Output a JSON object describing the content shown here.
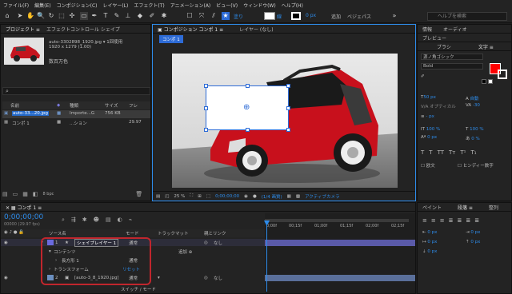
{
  "menu": [
    "ファイル(F)",
    "編集(E)",
    "コンポジション(C)",
    "レイヤー(L)",
    "エフェクト(T)",
    "アニメーション(A)",
    "ビュー(V)",
    "ウィンドウ(W)",
    "ヘルプ(H)"
  ],
  "toolbar": {
    "fill_label": "塗り",
    "stroke_label": "線",
    "stroke_value": "0 px",
    "add_label": "追加",
    "bezier_label": "ベジェパス",
    "search_placeholder": "ヘルプを検索"
  },
  "project": {
    "tab_project": "プロジェクト ≡",
    "tab_effect": "エフェクトコントロール シェイプ",
    "item_name": "auto-3302898_1920.jpg ▾ 1回使用",
    "item_info": "1920 x 1279 (1.00)",
    "item_color": "数百万色",
    "col_name": "名前",
    "col_type": "種類",
    "col_size": "サイズ",
    "col_frame": "フレ",
    "rows": [
      {
        "name": "auto-33...20.jpg",
        "type": "Importe...G",
        "size": "756 KB",
        "frame": ""
      },
      {
        "name": "コンポ 1",
        "type": "...ション",
        "size": "",
        "frame": "29.97"
      }
    ],
    "bpc": "8 bpc"
  },
  "comp": {
    "tab_label": "コンポジション コンポ 1 ≡",
    "layer_tab": "レイヤー (なし)",
    "comp_chip": "コンポ 1",
    "zoom": "25 %",
    "timecode": "0;00;00;00",
    "resolution": "(1/4 画質)",
    "camera": "アクティブカメラ"
  },
  "right": {
    "tab_info": "情報",
    "tab_audio": "オーディオ",
    "tab_preview": "プレビュー",
    "tab_brush": "ブラシ",
    "tab_text": "文字 ≡",
    "font": "源ノ角ゴシック",
    "style": "Bold",
    "size": "50 px",
    "leading": "自動",
    "tracking": "-30",
    "kerning": "オプティカル",
    "stroke": "- px",
    "vscale": "100 %",
    "hscale": "100 %",
    "baseline": "0 px",
    "tsume": "0 %",
    "faux_bold": "欧文",
    "small_caps": "ヒンディー数字",
    "tab_paint": "ペイント",
    "tab_para": "段落 ≡",
    "tab_align": "整列",
    "para_values": [
      "0 px",
      "0 px",
      "0 px",
      "0 px",
      "0 px"
    ]
  },
  "timeline": {
    "tab": "コンポ 1 ≡",
    "timecode": "0;00;00;00",
    "fps": "00000 (29.97 fps)",
    "col_source": "ソース名",
    "col_mode": "モード",
    "col_trkmat": "トラックマット",
    "col_parent": "親とリンク",
    "layers": [
      {
        "num": "1",
        "name": "シェイプレイヤー 1",
        "mode": "通常",
        "parent": "なし"
      },
      {
        "num": "2",
        "name": "[auto-3_8_1920.jpg]",
        "mode": "通常",
        "parent": "なし"
      }
    ],
    "contents": "コンテンツ",
    "add": "追加",
    "rect": "長方形 1",
    "rect_mode": "通常",
    "transform": "トランスフォーム",
    "reset": "リセット",
    "footer": "スイッチ / モード",
    "ruler": [
      "0;00f",
      "00;15f",
      "01;00f",
      "01;15f",
      "02;00f",
      "02;15f"
    ]
  }
}
